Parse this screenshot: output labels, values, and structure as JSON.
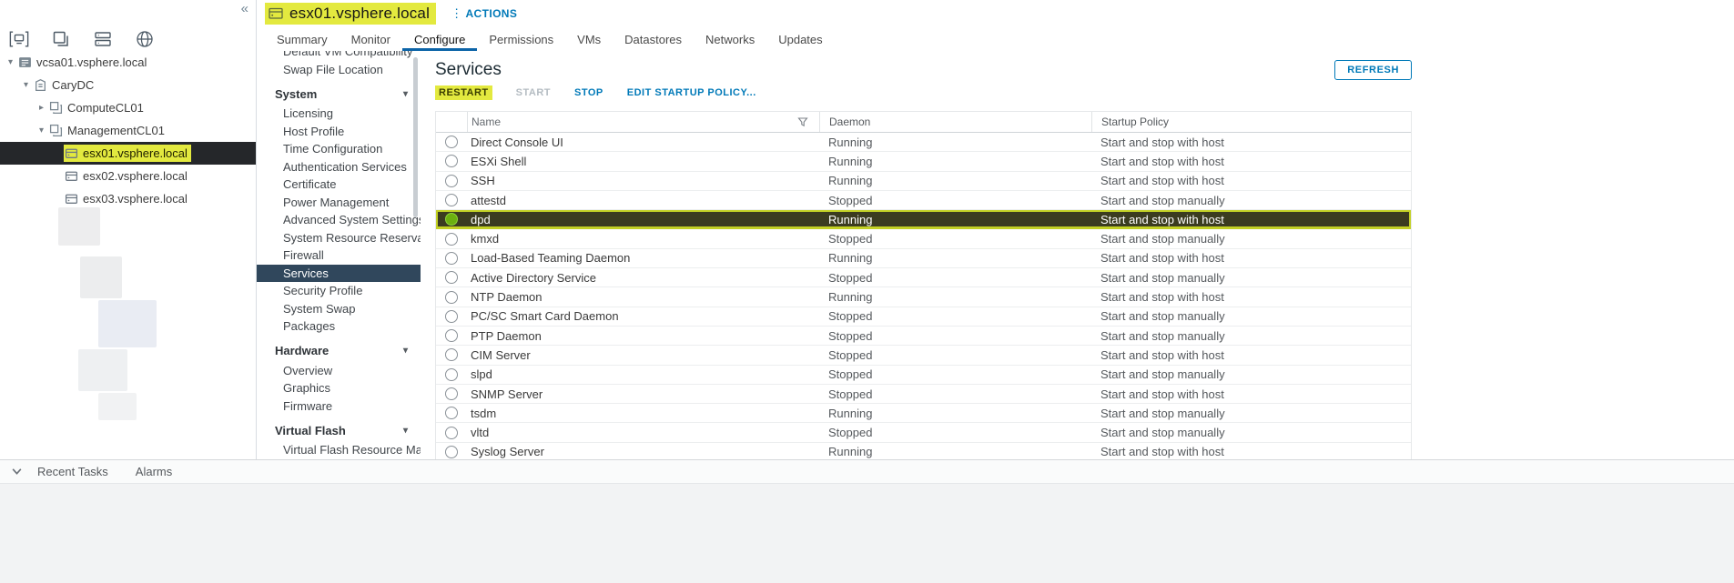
{
  "colors": {
    "accent_blue": "#0079b8",
    "highlight_yellow": "#e3e93f",
    "selected_row_bg": "#3b3c20",
    "selected_row_border": "#c3d124",
    "confignav_selected_bg": "#30475c",
    "tree_selected_bg": "#25272a",
    "radio_on_green": "#6cb00f"
  },
  "sidebar": {
    "collapse_icon": "chevron-double-left-icon",
    "icons": [
      {
        "name": "hosts-and-clusters-icon",
        "active": true
      },
      {
        "name": "vms-and-templates-icon",
        "active": false
      },
      {
        "name": "storage-icon",
        "active": false
      },
      {
        "name": "networking-icon",
        "active": false
      }
    ],
    "tree": [
      {
        "label": "vcsa01.vsphere.local",
        "level": 0,
        "expander": "down",
        "icon": "vcenter-icon",
        "selected": false,
        "highlighted": false
      },
      {
        "label": "CaryDC",
        "level": 1,
        "expander": "down",
        "icon": "datacenter-icon",
        "selected": false,
        "highlighted": false
      },
      {
        "label": "ComputeCL01",
        "level": 2,
        "expander": "right",
        "icon": "cluster-icon",
        "selected": false,
        "highlighted": false
      },
      {
        "label": "ManagementCL01",
        "level": 2,
        "expander": "down",
        "icon": "cluster-icon",
        "selected": false,
        "highlighted": false
      },
      {
        "label": "esx01.vsphere.local",
        "level": 3,
        "expander": "",
        "icon": "host-icon",
        "selected": true,
        "highlighted": true
      },
      {
        "label": "esx02.vsphere.local",
        "level": 3,
        "expander": "",
        "icon": "host-icon",
        "selected": false,
        "highlighted": false
      },
      {
        "label": "esx03.vsphere.local",
        "level": 3,
        "expander": "",
        "icon": "host-icon",
        "selected": false,
        "highlighted": false
      }
    ]
  },
  "header": {
    "title": "esx01.vsphere.local",
    "title_highlighted": true,
    "actions_label": "ACTIONS",
    "tabs": [
      {
        "label": "Summary",
        "active": false
      },
      {
        "label": "Monitor",
        "active": false
      },
      {
        "label": "Configure",
        "active": true
      },
      {
        "label": "Permissions",
        "active": false
      },
      {
        "label": "VMs",
        "active": false
      },
      {
        "label": "Datastores",
        "active": false
      },
      {
        "label": "Networks",
        "active": false
      },
      {
        "label": "Updates",
        "active": false
      }
    ]
  },
  "confignav": {
    "items": [
      {
        "label": "Default VM Compatibility",
        "type": "item",
        "selected": false
      },
      {
        "label": "Swap File Location",
        "type": "item",
        "selected": false
      },
      {
        "label": "System",
        "type": "section",
        "expanded": true
      },
      {
        "label": "Licensing",
        "type": "item",
        "selected": false
      },
      {
        "label": "Host Profile",
        "type": "item",
        "selected": false
      },
      {
        "label": "Time Configuration",
        "type": "item",
        "selected": false
      },
      {
        "label": "Authentication Services",
        "type": "item",
        "selected": false
      },
      {
        "label": "Certificate",
        "type": "item",
        "selected": false
      },
      {
        "label": "Power Management",
        "type": "item",
        "selected": false
      },
      {
        "label": "Advanced System Settings",
        "type": "item",
        "selected": false
      },
      {
        "label": "System Resource Reservati...",
        "type": "item",
        "selected": false
      },
      {
        "label": "Firewall",
        "type": "item",
        "selected": false
      },
      {
        "label": "Services",
        "type": "item",
        "selected": true
      },
      {
        "label": "Security Profile",
        "type": "item",
        "selected": false
      },
      {
        "label": "System Swap",
        "type": "item",
        "selected": false
      },
      {
        "label": "Packages",
        "type": "item",
        "selected": false
      },
      {
        "label": "Hardware",
        "type": "section",
        "expanded": true
      },
      {
        "label": "Overview",
        "type": "item",
        "selected": false
      },
      {
        "label": "Graphics",
        "type": "item",
        "selected": false
      },
      {
        "label": "Firmware",
        "type": "item",
        "selected": false
      },
      {
        "label": "Virtual Flash",
        "type": "section",
        "expanded": true
      },
      {
        "label": "Virtual Flash Resource Man...",
        "type": "item",
        "selected": false
      }
    ]
  },
  "main": {
    "title": "Services",
    "refresh_label": "REFRESH",
    "toolbar": [
      {
        "label": "RESTART",
        "state": "highlighted"
      },
      {
        "label": "START",
        "state": "disabled"
      },
      {
        "label": "STOP",
        "state": "enabled"
      },
      {
        "label": "EDIT STARTUP POLICY...",
        "state": "enabled"
      }
    ],
    "table": {
      "columns": [
        "Name",
        "Daemon",
        "Startup Policy"
      ],
      "rows": [
        {
          "name": "Direct Console UI",
          "daemon": "Running",
          "policy": "Start and stop with host",
          "selected": false
        },
        {
          "name": "ESXi Shell",
          "daemon": "Running",
          "policy": "Start and stop with host",
          "selected": false
        },
        {
          "name": "SSH",
          "daemon": "Running",
          "policy": "Start and stop with host",
          "selected": false
        },
        {
          "name": "attestd",
          "daemon": "Stopped",
          "policy": "Start and stop manually",
          "selected": false
        },
        {
          "name": "dpd",
          "daemon": "Running",
          "policy": "Start and stop with host",
          "selected": true
        },
        {
          "name": "kmxd",
          "daemon": "Stopped",
          "policy": "Start and stop manually",
          "selected": false
        },
        {
          "name": "Load-Based Teaming Daemon",
          "daemon": "Running",
          "policy": "Start and stop with host",
          "selected": false
        },
        {
          "name": "Active Directory Service",
          "daemon": "Stopped",
          "policy": "Start and stop manually",
          "selected": false
        },
        {
          "name": "NTP Daemon",
          "daemon": "Running",
          "policy": "Start and stop with host",
          "selected": false
        },
        {
          "name": "PC/SC Smart Card Daemon",
          "daemon": "Stopped",
          "policy": "Start and stop manually",
          "selected": false
        },
        {
          "name": "PTP Daemon",
          "daemon": "Stopped",
          "policy": "Start and stop manually",
          "selected": false
        },
        {
          "name": "CIM Server",
          "daemon": "Stopped",
          "policy": "Start and stop with host",
          "selected": false
        },
        {
          "name": "slpd",
          "daemon": "Stopped",
          "policy": "Start and stop manually",
          "selected": false
        },
        {
          "name": "SNMP Server",
          "daemon": "Stopped",
          "policy": "Start and stop with host",
          "selected": false
        },
        {
          "name": "tsdm",
          "daemon": "Running",
          "policy": "Start and stop manually",
          "selected": false
        },
        {
          "name": "vltd",
          "daemon": "Stopped",
          "policy": "Start and stop manually",
          "selected": false
        },
        {
          "name": "Syslog Server",
          "daemon": "Running",
          "policy": "Start and stop with host",
          "selected": false
        }
      ]
    }
  },
  "bottombar": {
    "items": [
      {
        "label": "Recent Tasks"
      },
      {
        "label": "Alarms"
      }
    ]
  }
}
